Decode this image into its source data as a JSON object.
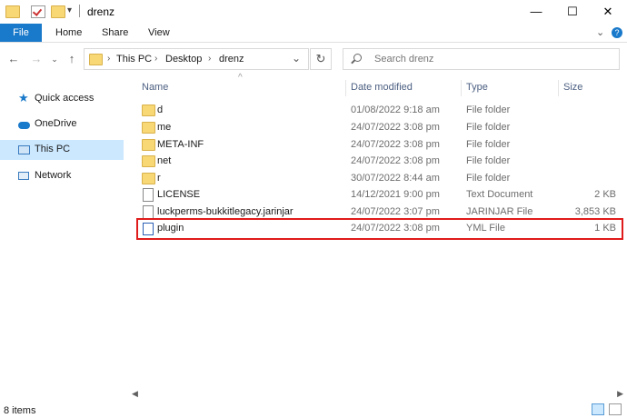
{
  "window": {
    "title": "drenz",
    "minimize": "—",
    "maximize": "☐",
    "close": "✕"
  },
  "ribbon": {
    "file": "File",
    "tabs": [
      "Home",
      "Share",
      "View"
    ],
    "expand": "⌄"
  },
  "address": {
    "crumbs": [
      "This PC",
      "Desktop",
      "drenz"
    ],
    "dropdown": "⌄",
    "refresh": "↻"
  },
  "search": {
    "placeholder": "Search drenz"
  },
  "sidebar": {
    "items": [
      {
        "label": "Quick access",
        "icon": "star-icon"
      },
      {
        "label": "OneDrive",
        "icon": "cloud-icon"
      },
      {
        "label": "This PC",
        "icon": "computer-icon"
      },
      {
        "label": "Network",
        "icon": "network-icon"
      }
    ]
  },
  "columns": {
    "name": "Name",
    "date": "Date modified",
    "type": "Type",
    "size": "Size"
  },
  "files": [
    {
      "name": "d",
      "date": "01/08/2022 9:18 am",
      "type": "File folder",
      "size": "",
      "icon": "folder-icon"
    },
    {
      "name": "me",
      "date": "24/07/2022 3:08 pm",
      "type": "File folder",
      "size": "",
      "icon": "folder-icon"
    },
    {
      "name": "META-INF",
      "date": "24/07/2022 3:08 pm",
      "type": "File folder",
      "size": "",
      "icon": "folder-icon"
    },
    {
      "name": "net",
      "date": "24/07/2022 3:08 pm",
      "type": "File folder",
      "size": "",
      "icon": "folder-icon"
    },
    {
      "name": "r",
      "date": "30/07/2022 8:44 am",
      "type": "File folder",
      "size": "",
      "icon": "folder-icon"
    },
    {
      "name": "LICENSE",
      "date": "14/12/2021 9:00 pm",
      "type": "Text Document",
      "size": "2 KB",
      "icon": "document-icon"
    },
    {
      "name": "luckperms-bukkitlegacy.jarinjar",
      "date": "24/07/2022 3:07 pm",
      "type": "JARINJAR File",
      "size": "3,853 KB",
      "icon": "document-icon"
    },
    {
      "name": "plugin",
      "date": "24/07/2022 3:08 pm",
      "type": "YML File",
      "size": "1 KB",
      "icon": "yml-file-icon",
      "highlighted": true
    }
  ],
  "status": {
    "count": "8 items"
  },
  "colors": {
    "accent": "#1979ca",
    "selected": "#cce8ff",
    "highlight": "#e01b1b",
    "folder": "#f8d775"
  }
}
